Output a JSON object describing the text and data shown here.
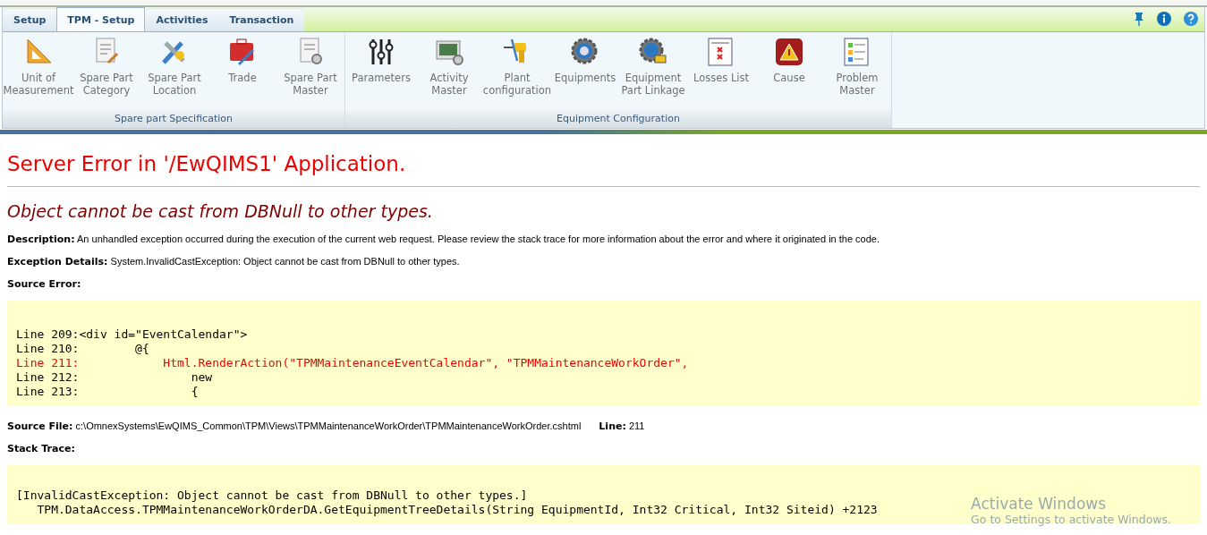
{
  "tabs": [
    {
      "label": "Setup",
      "selected": false
    },
    {
      "label": "TPM - Setup",
      "selected": true
    },
    {
      "label": "Activities",
      "selected": false
    },
    {
      "label": "Transaction",
      "selected": false
    }
  ],
  "ribbon_groups": [
    {
      "title": "Spare part Specification",
      "items": [
        {
          "label": "Unit of\nMeasurement"
        },
        {
          "label": "Spare Part\nCategory"
        },
        {
          "label": "Spare Part\nLocation"
        },
        {
          "label": "Trade"
        },
        {
          "label": "Spare Part\nMaster"
        }
      ]
    },
    {
      "title": "Equipment Configuration",
      "items": [
        {
          "label": "Parameters"
        },
        {
          "label": "Activity\nMaster"
        },
        {
          "label": "Plant\nconfiguration"
        },
        {
          "label": "Equipments"
        },
        {
          "label": "Equipment\nPart Linkage"
        },
        {
          "label": "Losses List"
        },
        {
          "label": "Cause"
        },
        {
          "label": "Problem\nMaster"
        }
      ]
    }
  ],
  "error_page": {
    "title": "Server Error in '/EwQIMS1' Application.",
    "message": "Object cannot be cast from DBNull to other types.",
    "fields": [
      {
        "label": "Description:",
        "value": "An unhandled exception occurred during the execution of the current web request. Please review the stack trace for more information about the error and where it originated in the code."
      },
      {
        "label": "Exception Details:",
        "value": "System.InvalidCastException: Object cannot be cast from DBNull to other types."
      }
    ],
    "source_error_label": "Source Error:",
    "source_lines": [
      {
        "text": "Line 209:<div id=\"EventCalendar\">",
        "highlighted": false
      },
      {
        "text": "Line 210:        @{",
        "highlighted": false
      },
      {
        "text": "Line 211:            Html.RenderAction(\"TPMMaintenanceEventCalendar\", \"TPMMaintenanceWorkOrder\",",
        "highlighted": true
      },
      {
        "text": "Line 212:                new",
        "highlighted": false
      },
      {
        "text": "Line 213:                {",
        "highlighted": false
      }
    ],
    "source_file_label": "Source File:",
    "source_file": "c:\\OmnexSystems\\EwQIMS_Common\\TPM\\Views\\TPMMaintenanceWorkOrder\\TPMMaintenanceWorkOrder.cshtml",
    "line_label": "Line:",
    "line": "211",
    "stack_trace_label": "Stack Trace:",
    "stack_lines": [
      "[InvalidCastException: Object cannot be cast from DBNull to other types.]",
      "   TPM.DataAccess.TPMMaintenanceWorkOrderDA.GetEquipmentTreeDetails(String EquipmentId, Int32 Critical, Int32 Siteid) +2123"
    ]
  },
  "activation_notice": {
    "title": "Activate Windows",
    "subtitle": "Go to Settings to activate Windows."
  }
}
